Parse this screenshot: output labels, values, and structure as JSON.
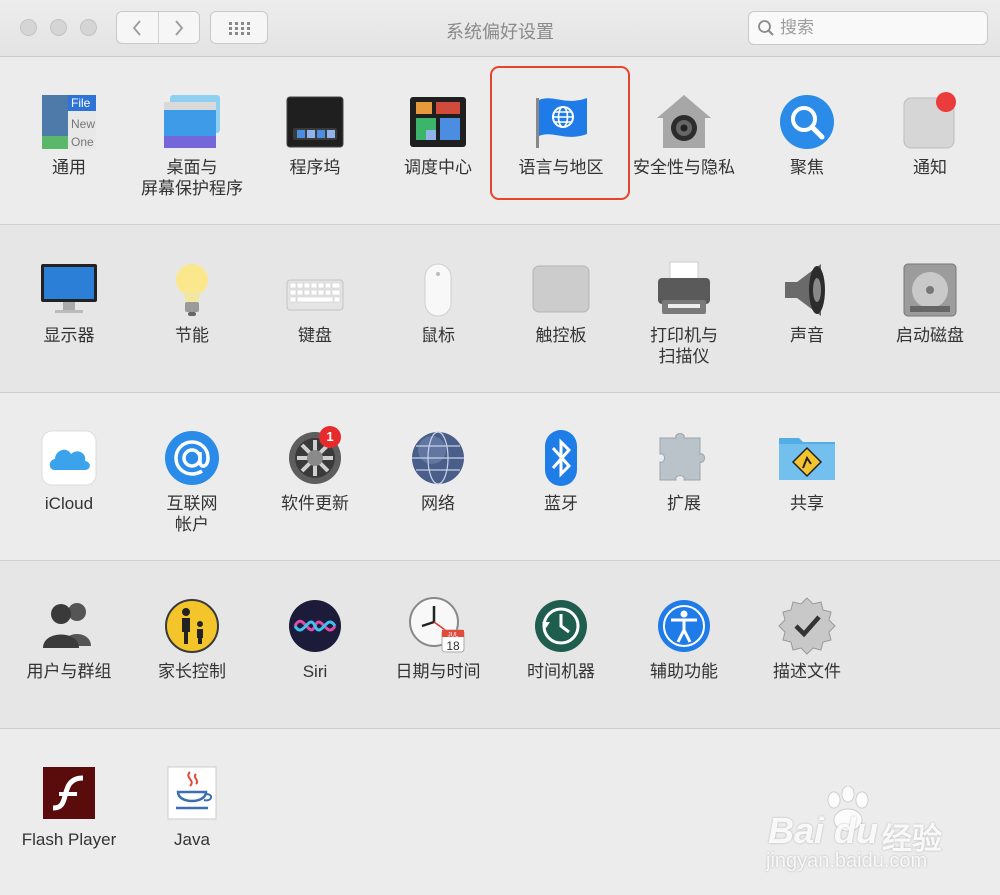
{
  "window": {
    "title": "系统偏好设置",
    "search_placeholder": "搜索"
  },
  "rows": [
    {
      "items": [
        {
          "id": "general",
          "label": "通用"
        },
        {
          "id": "desktop",
          "label": "桌面与\n屏幕保护程序"
        },
        {
          "id": "dock",
          "label": "程序坞"
        },
        {
          "id": "mission",
          "label": "调度中心"
        },
        {
          "id": "language",
          "label": "语言与地区",
          "highlighted": true
        },
        {
          "id": "security",
          "label": "安全性与隐私"
        },
        {
          "id": "spotlight",
          "label": "聚焦"
        },
        {
          "id": "notifications",
          "label": "通知"
        }
      ]
    },
    {
      "items": [
        {
          "id": "displays",
          "label": "显示器"
        },
        {
          "id": "energy",
          "label": "节能"
        },
        {
          "id": "keyboard",
          "label": "键盘"
        },
        {
          "id": "mouse",
          "label": "鼠标"
        },
        {
          "id": "trackpad",
          "label": "触控板"
        },
        {
          "id": "printers",
          "label": "打印机与\n扫描仪"
        },
        {
          "id": "sound",
          "label": "声音"
        },
        {
          "id": "startup",
          "label": "启动磁盘"
        }
      ]
    },
    {
      "items": [
        {
          "id": "icloud",
          "label": "iCloud"
        },
        {
          "id": "internet",
          "label": "互联网\n帐户"
        },
        {
          "id": "update",
          "label": "软件更新",
          "badge": "1"
        },
        {
          "id": "network",
          "label": "网络"
        },
        {
          "id": "bluetooth",
          "label": "蓝牙"
        },
        {
          "id": "extensions",
          "label": "扩展"
        },
        {
          "id": "sharing",
          "label": "共享"
        }
      ]
    },
    {
      "items": [
        {
          "id": "users",
          "label": "用户与群组"
        },
        {
          "id": "parental",
          "label": "家长控制"
        },
        {
          "id": "siri",
          "label": "Siri"
        },
        {
          "id": "datetime",
          "label": "日期与时间"
        },
        {
          "id": "timemachine",
          "label": "时间机器"
        },
        {
          "id": "accessibility",
          "label": "辅助功能"
        },
        {
          "id": "profiles",
          "label": "描述文件"
        }
      ]
    },
    {
      "items": [
        {
          "id": "flash",
          "label": "Flash Player"
        },
        {
          "id": "java",
          "label": "Java"
        }
      ]
    }
  ],
  "icon_text": {
    "general_file": "File",
    "general_new": "New",
    "general_open": "One",
    "calendar_month": "JUL",
    "calendar_day": "18"
  },
  "watermark": {
    "brand": "Bai du",
    "cn": "经验",
    "url": "jingyan.baidu.com"
  },
  "colors": {
    "highlight": "#e9432b",
    "badge": "#e52b2b"
  }
}
